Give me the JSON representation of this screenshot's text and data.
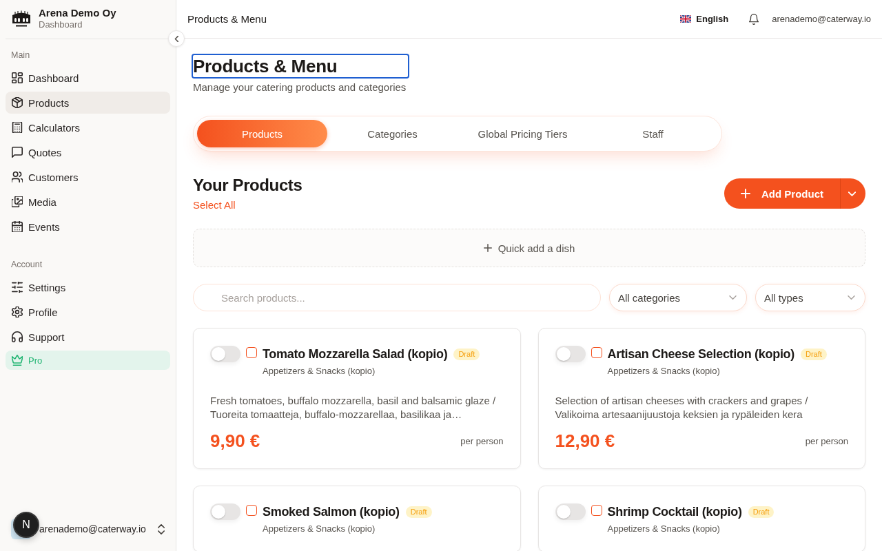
{
  "sidebar": {
    "org": {
      "name": "Arena Demo Oy",
      "subtitle": "Dashboard"
    },
    "sections": [
      {
        "heading": "Main",
        "items": [
          {
            "label": "Dashboard",
            "kind": "nav",
            "selected": false
          },
          {
            "label": "Products",
            "kind": "nav",
            "selected": true
          },
          {
            "label": "Calculators",
            "kind": "nav",
            "selected": false
          },
          {
            "label": "Quotes",
            "kind": "nav",
            "selected": false
          },
          {
            "label": "Customers",
            "kind": "nav",
            "selected": false
          },
          {
            "label": "Media",
            "kind": "nav",
            "selected": false
          },
          {
            "label": "Events",
            "kind": "nav",
            "selected": false
          }
        ]
      },
      {
        "heading": "Account",
        "items": [
          {
            "label": "Settings",
            "kind": "nav",
            "selected": false
          },
          {
            "label": "Profile",
            "kind": "nav",
            "selected": false
          },
          {
            "label": "Support",
            "kind": "nav",
            "selected": false
          },
          {
            "label": "Pro",
            "kind": "upgrade",
            "selected": false
          }
        ]
      }
    ],
    "user": {
      "email": "arenademo@caterway.io"
    }
  },
  "dev_tools_button": {
    "label": "N"
  },
  "top_bar": {
    "title": "Products & Menu",
    "language": "English",
    "user_email": "arenademo@caterway.io"
  },
  "page": {
    "title": "Products & Menu",
    "subtitle": "Manage your catering products and categories"
  },
  "tabs": [
    {
      "label": "Products",
      "selected": true
    },
    {
      "label": "Categories",
      "selected": false
    },
    {
      "label": "Global Pricing Tiers",
      "selected": false
    },
    {
      "label": "Staff",
      "selected": false
    }
  ],
  "products_section": {
    "title": "Your Products",
    "select_all": "Select All",
    "add_button": "Add Product",
    "quick_add": "Quick add a dish"
  },
  "filters": {
    "search": {
      "placeholder": "Search products..."
    },
    "category": "All categories",
    "type": "All types"
  },
  "products": [
    {
      "name": "Tomato Mozzarella Salad (kopio)",
      "status": "Draft",
      "category": "Appetizers & Snacks (kopio)",
      "description": "Fresh tomatoes, buffalo mozzarella, basil and balsamic glaze / Tuoreita tomaatteja, buffalo-mozzarellaa, basilikaa ja…",
      "price": "9,90 €",
      "unit": "per person",
      "on": false,
      "checked": false
    },
    {
      "name": "Artisan Cheese Selection (kopio)",
      "status": "Draft",
      "category": "Appetizers & Snacks (kopio)",
      "description": "Selection of artisan cheeses with crackers and grapes / Valikoima artesaanijuustoja keksien ja rypäleiden kera",
      "price": "12,90 €",
      "unit": "per person",
      "on": false,
      "checked": false
    },
    {
      "name": "Smoked Salmon (kopio)",
      "status": "Draft",
      "category": "Appetizers & Snacks (kopio)",
      "on": false,
      "checked": false
    },
    {
      "name": "Shrimp Cocktail (kopio)",
      "status": "Draft",
      "category": "Appetizers & Snacks (kopio)",
      "on": false,
      "checked": false
    }
  ]
}
